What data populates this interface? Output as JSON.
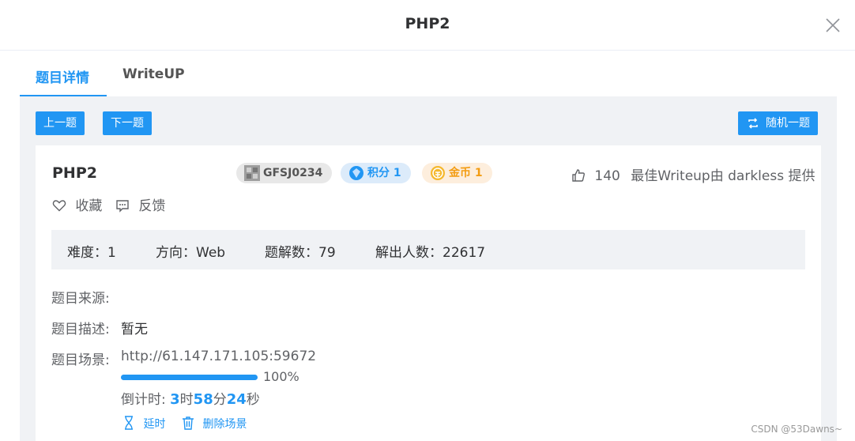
{
  "modal": {
    "title": "PHP2"
  },
  "tabs": [
    {
      "label": "题目详情",
      "active": true
    },
    {
      "label": "WriteUP",
      "active": false
    }
  ],
  "nav": {
    "prev": "上一题",
    "next": "下一题",
    "random": "随机一题"
  },
  "challenge": {
    "title": "PHP2",
    "id_tag": "GFSJ0234",
    "score_tag": "积分 1",
    "coin_tag": "金币 1",
    "likes": "140",
    "best_writeup": "最佳Writeup由 darkless 提供",
    "favorite": "收藏",
    "feedback": "反馈"
  },
  "stats": {
    "difficulty": "难度：1",
    "direction": "方向：Web",
    "solves": "题解数：79",
    "solvers": "解出人数：22617"
  },
  "info": {
    "source_label": "题目来源:",
    "description_label": "题目描述:",
    "description_value": "暂无",
    "scene_label": "题目场景:",
    "scene_url": "http://61.147.171.105:59672",
    "progress": 1.0,
    "progress_text": "100%",
    "countdown_prefix": "倒计时: ",
    "hours": "3",
    "hours_unit": "时",
    "minutes": "58",
    "minutes_unit": "分",
    "seconds": "24",
    "seconds_unit": "秒",
    "extend": "延时",
    "delete_scene": "删除场景"
  },
  "colors": {
    "accent": "#2196f3",
    "coin": "#f39c12"
  },
  "watermark": "CSDN @53Dawns~"
}
